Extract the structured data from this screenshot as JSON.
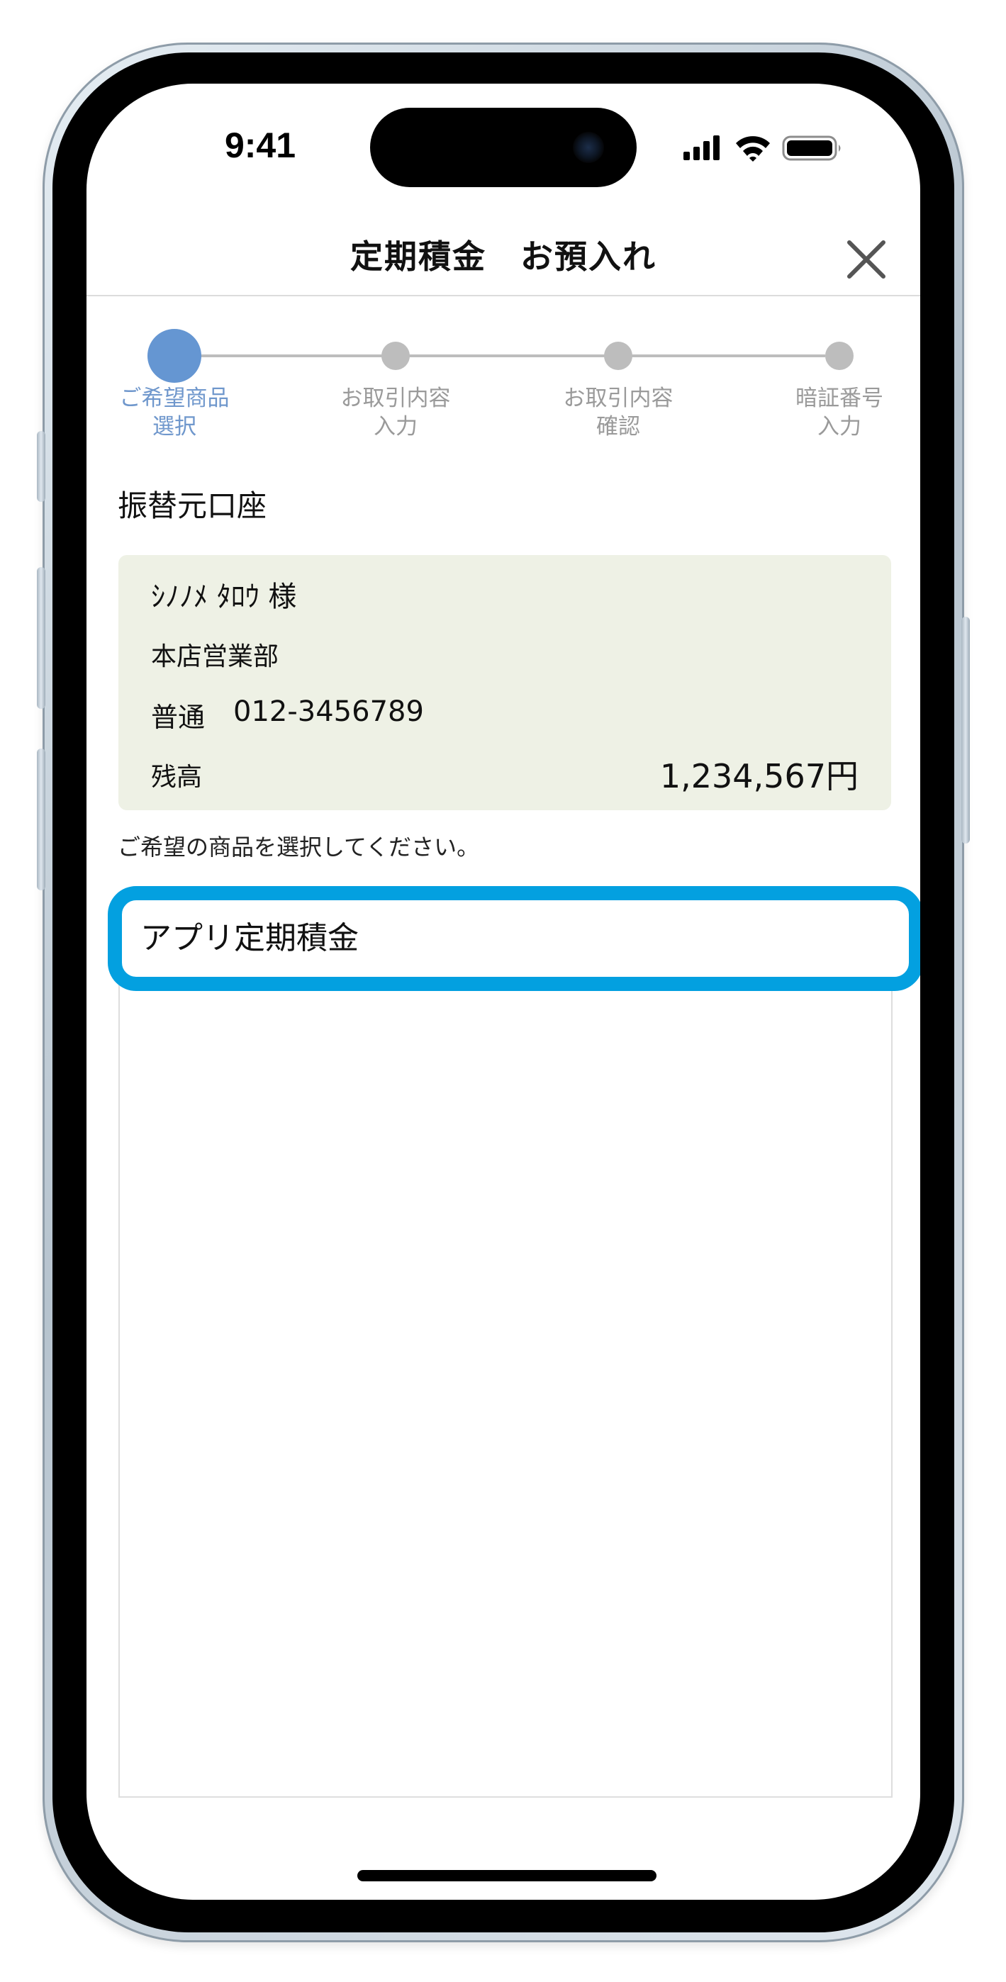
{
  "status_bar": {
    "time": "9:41"
  },
  "header": {
    "title": "定期積金　お預入れ"
  },
  "steps": [
    {
      "line1": "ご希望商品",
      "line2": "選択",
      "active": true
    },
    {
      "line1": "お取引内容",
      "line2": "入力",
      "active": false
    },
    {
      "line1": "お取引内容",
      "line2": "確認",
      "active": false
    },
    {
      "line1": "暗証番号",
      "line2": "入力",
      "active": false
    }
  ],
  "source_account": {
    "section_title": "振替元口座",
    "name": "ｼﾉﾉﾒ ﾀﾛｳ 様",
    "branch": "本店営業部",
    "type": "普通",
    "number": "012-3456789",
    "balance_label": "残高",
    "balance": "1,234,567円"
  },
  "instruction": "ご希望の商品を選択してください。",
  "products": [
    {
      "label": "アプリ定期積金"
    }
  ],
  "colors": {
    "accent_active_step": "#6596d2",
    "inactive_step": "#bdbdbd",
    "card_background": "#eef1e5",
    "highlight_border": "#03a0e0"
  }
}
